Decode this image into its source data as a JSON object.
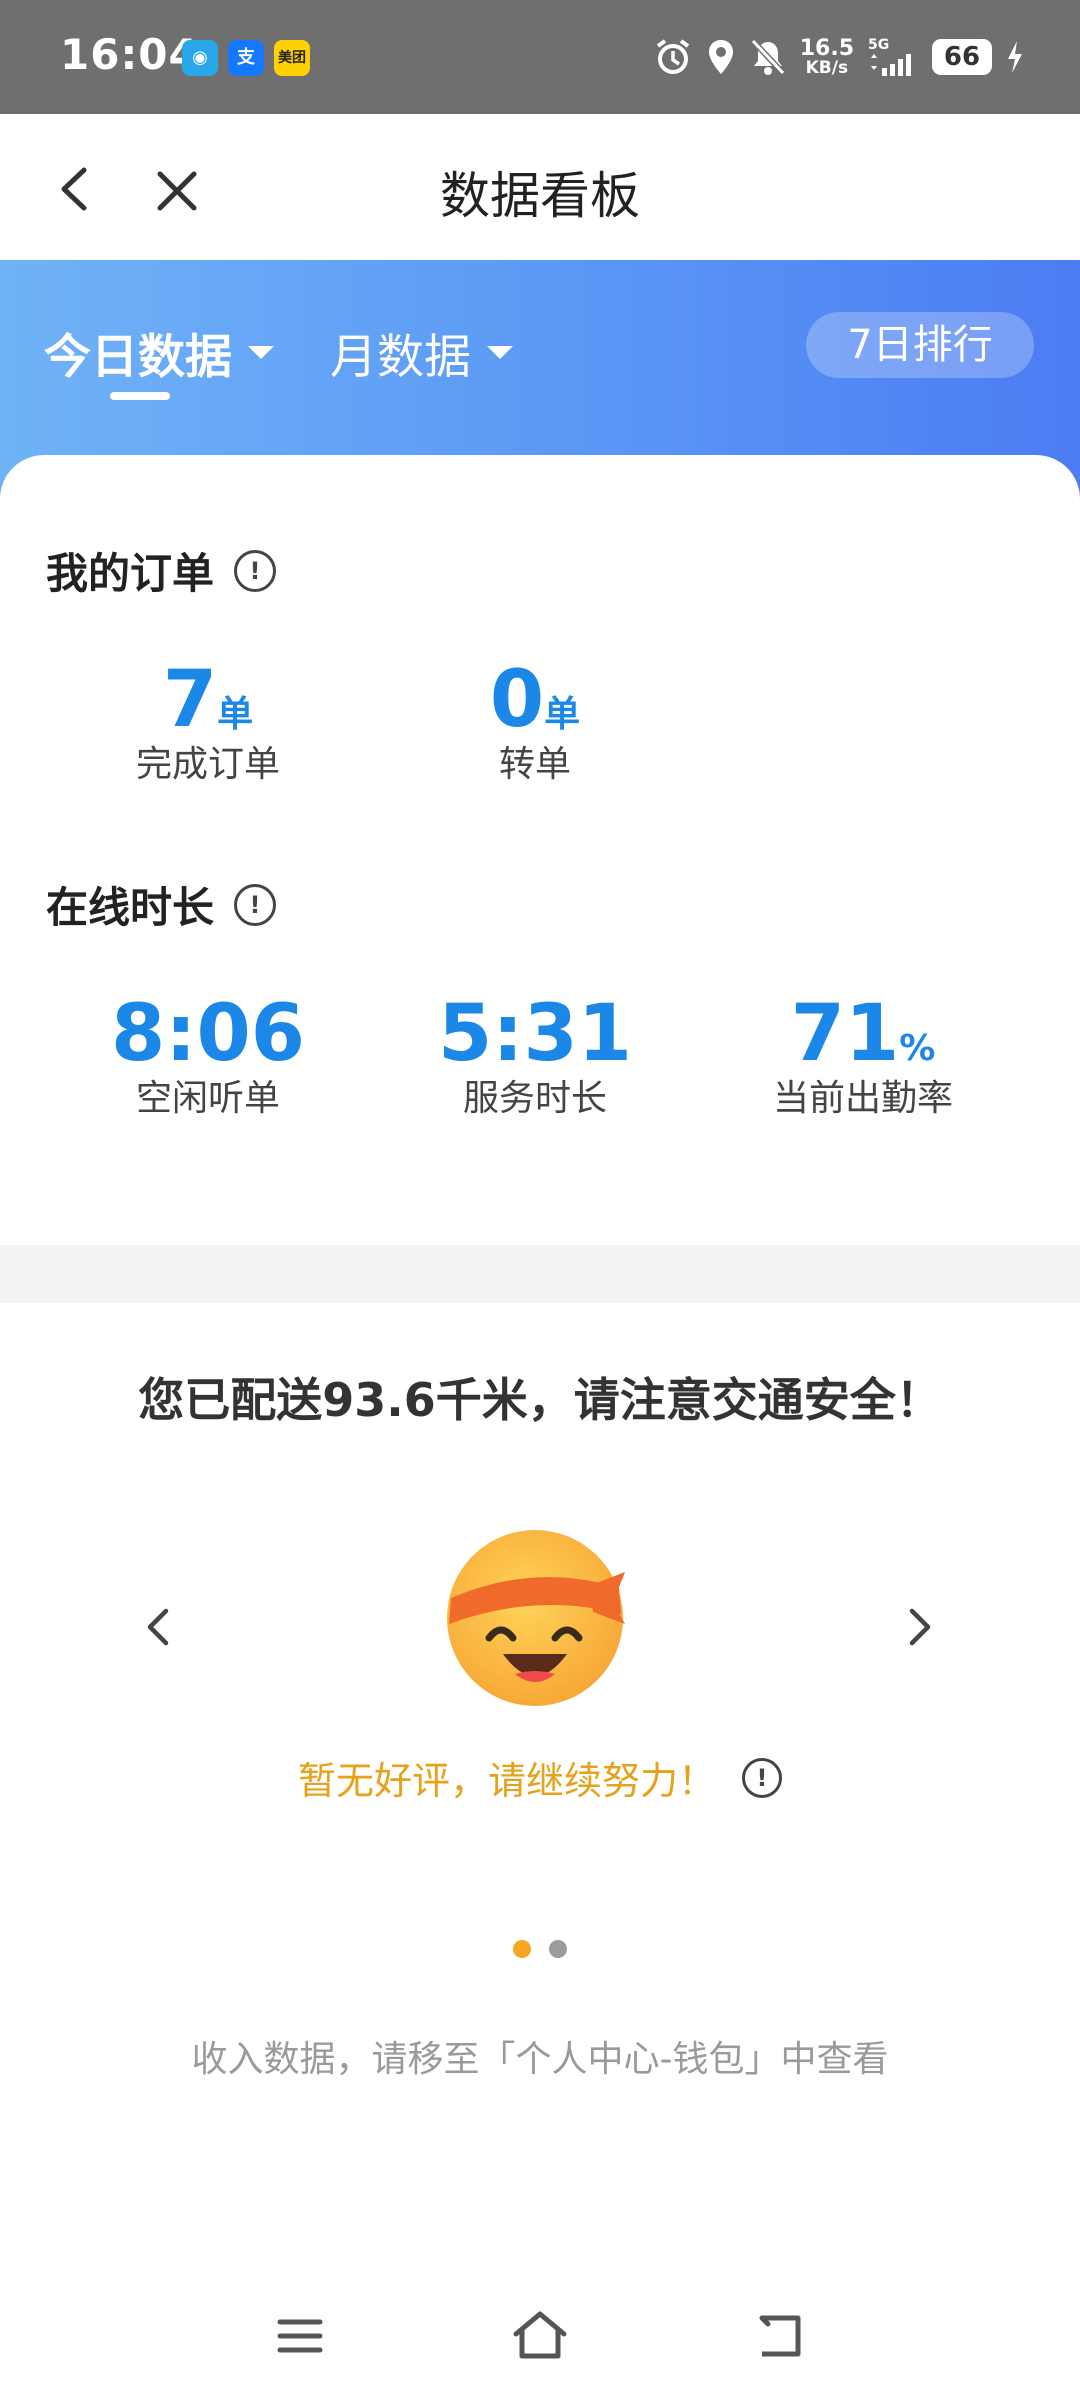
{
  "status_bar": {
    "time": "16:04",
    "app_icons": [
      "app-icon",
      "支",
      "美团"
    ],
    "speed_value": "16.5",
    "speed_unit": "KB/s",
    "network": "5G",
    "battery": "66"
  },
  "header": {
    "title": "数据看板"
  },
  "tabs": {
    "today": "今日数据",
    "month": "月数据",
    "rank_button": "7日排行"
  },
  "orders": {
    "title": "我的订单",
    "items": [
      {
        "value": "7",
        "unit": "单",
        "label": "完成订单"
      },
      {
        "value": "0",
        "unit": "单",
        "label": "转单"
      }
    ]
  },
  "online": {
    "title": "在线时长",
    "items": [
      {
        "value": "8:06",
        "unit": "",
        "label": "空闲听单"
      },
      {
        "value": "5:31",
        "unit": "",
        "label": "服务时长"
      },
      {
        "value": "71",
        "unit": "%",
        "label": "当前出勤率"
      }
    ]
  },
  "distance_text": "您已配送93.6千米，请注意交通安全！",
  "praise_text": "暂无好评，请继续努力！",
  "pager": {
    "total": 2,
    "active": 0,
    "active_color": "#f5a623",
    "inactive_color": "#9b9b9b"
  },
  "income_hint": "收入数据，请移至「个人中心-钱包」中查看",
  "colors": {
    "accent_blue": "#1b88e8",
    "praise_orange": "#e6a21a",
    "header_gradient_start": "#6fb3f6",
    "header_gradient_end": "#4c7cf3"
  }
}
